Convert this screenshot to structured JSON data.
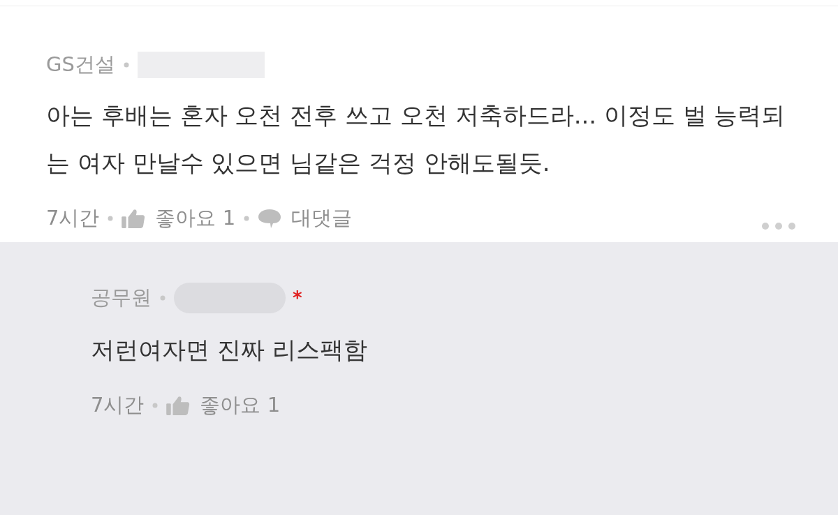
{
  "comment": {
    "author": "GS건설",
    "body": "아는 후배는 혼자 오천 전후 쓰고 오천 저축하드라... 이정도 벌 능력되는 여자 만날수 있으면 님같은 걱정 안해도될듯.",
    "time": "7시간",
    "likes": "좋아요 1",
    "reply_label": "대댓글"
  },
  "reply": {
    "author": "공무원",
    "author_mark": "*",
    "body": "저런여자면 진짜 리스팩함",
    "time": "7시간",
    "likes": "좋아요 1"
  }
}
